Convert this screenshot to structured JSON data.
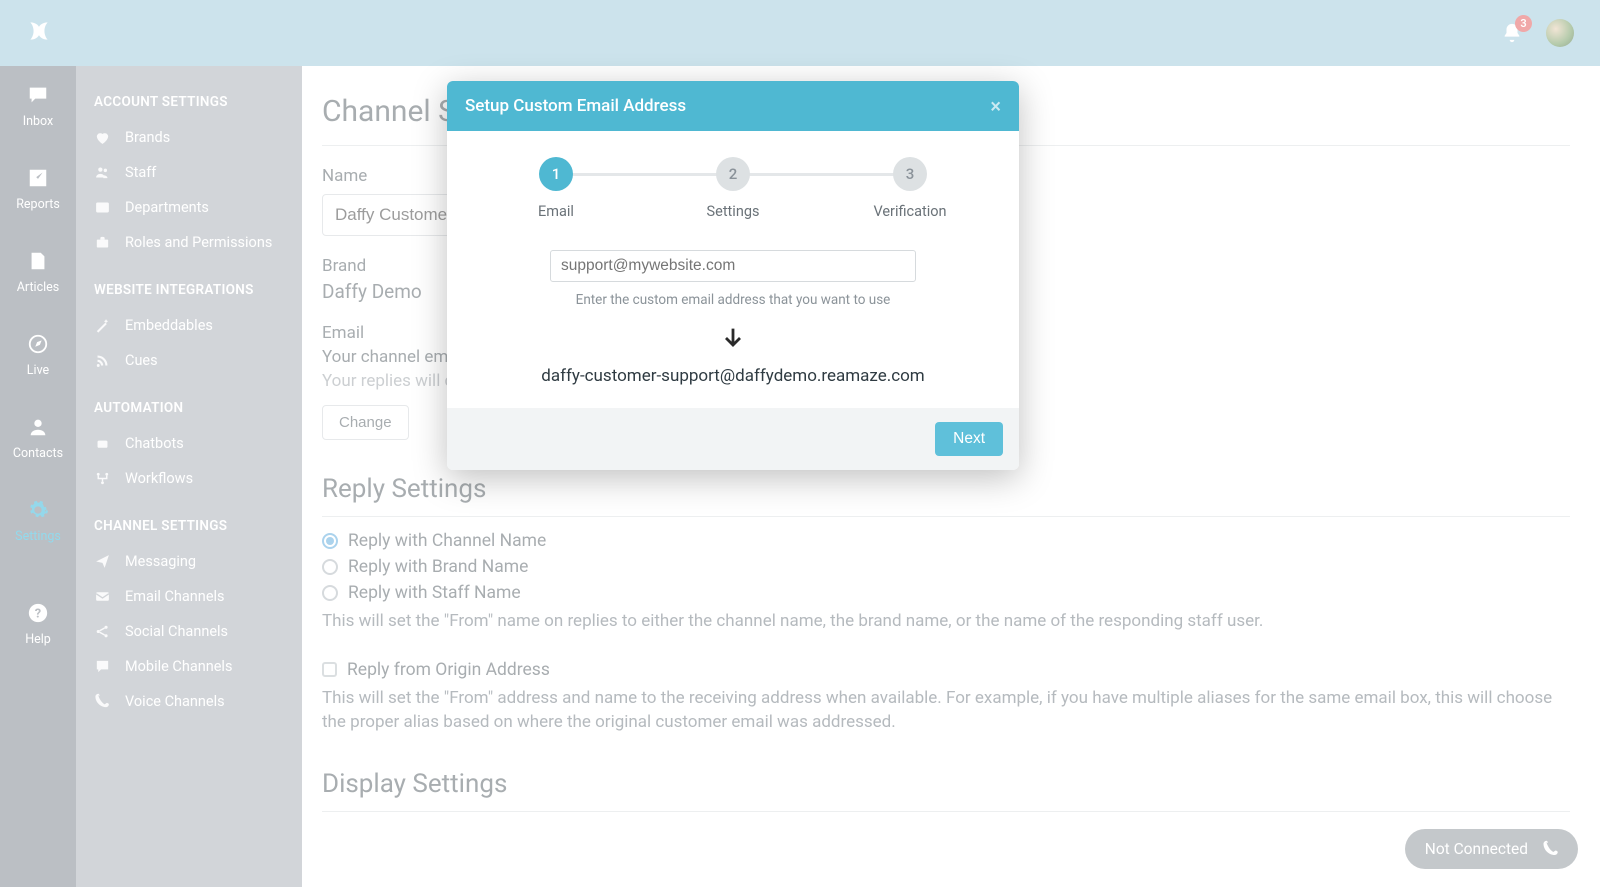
{
  "header": {
    "notification_count": "3"
  },
  "rail": {
    "items": [
      {
        "label": "Inbox"
      },
      {
        "label": "Reports"
      },
      {
        "label": "Articles"
      },
      {
        "label": "Live"
      },
      {
        "label": "Contacts"
      },
      {
        "label": "Settings"
      },
      {
        "label": "Help"
      }
    ]
  },
  "sidebar": {
    "groups": [
      {
        "title": "ACCOUNT SETTINGS",
        "items": [
          {
            "label": "Brands"
          },
          {
            "label": "Staff"
          },
          {
            "label": "Departments"
          },
          {
            "label": "Roles and Permissions"
          }
        ]
      },
      {
        "title": "WEBSITE INTEGRATIONS",
        "items": [
          {
            "label": "Embeddables"
          },
          {
            "label": "Cues"
          }
        ]
      },
      {
        "title": "AUTOMATION",
        "items": [
          {
            "label": "Chatbots"
          },
          {
            "label": "Workflows"
          }
        ]
      },
      {
        "title": "CHANNEL SETTINGS",
        "items": [
          {
            "label": "Messaging"
          },
          {
            "label": "Email Channels"
          },
          {
            "label": "Social Channels"
          },
          {
            "label": "Mobile Channels"
          },
          {
            "label": "Voice Channels"
          }
        ]
      }
    ]
  },
  "main": {
    "title": "Channel Settings",
    "name_label": "Name",
    "name_value": "Daffy Customer",
    "brand_label": "Brand",
    "brand_value": "Daffy Demo",
    "email_label": "Email",
    "email_line1": "Your channel email",
    "email_line2": "Your replies will c",
    "change_button": "Change",
    "reply_heading": "Reply Settings",
    "reply_options": [
      "Reply with Channel Name",
      "Reply with Brand Name",
      "Reply with Staff Name"
    ],
    "reply_help": "This will set the \"From\" name on replies to either the channel name, the brand name, or the name of the responding staff user.",
    "origin_label": "Reply from Origin Address",
    "origin_help": "This will set the \"From\" address and name to the receiving address when available. For example, if you have multiple aliases for the same email box, this will choose the proper alias based on where the original customer email was addressed.",
    "display_heading": "Display Settings"
  },
  "pill": {
    "label": "Not Connected"
  },
  "modal": {
    "title": "Setup Custom Email Address",
    "steps": [
      {
        "num": "1",
        "label": "Email"
      },
      {
        "num": "2",
        "label": "Settings"
      },
      {
        "num": "3",
        "label": "Verification"
      }
    ],
    "email_placeholder": "support@mywebsite.com",
    "email_hint": "Enter the custom email address that you want to use",
    "target_email": "daffy-customer-support@daffydemo.reamaze.com",
    "next_label": "Next"
  }
}
